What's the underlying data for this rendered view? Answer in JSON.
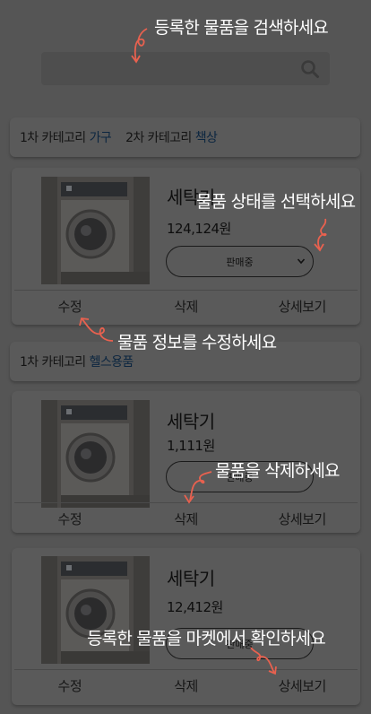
{
  "search": {
    "placeholder": ""
  },
  "categories": [
    {
      "first_label": "1차 카테고리",
      "first_value": "가구",
      "second_label": "2차 카테고리",
      "second_value": "책상"
    },
    {
      "first_label": "1차 카테고리",
      "first_value": "헬스용품"
    }
  ],
  "products": [
    {
      "title": "세탁기",
      "price": "124,124원",
      "status": "판매중",
      "edit": "수정",
      "delete": "삭제",
      "detail": "상세보기"
    },
    {
      "title": "세탁기",
      "price": "1,111원",
      "status": "판매중",
      "edit": "수정",
      "delete": "삭제",
      "detail": "상세보기"
    },
    {
      "title": "세탁기",
      "price": "12,412원",
      "status": "판매중",
      "edit": "수정",
      "delete": "삭제",
      "detail": "상세보기"
    }
  ],
  "tips": {
    "search": "등록한 물품을 검색하세요",
    "status": "물품 상태를 선택하세요",
    "edit": "물품 정보를 수정하세요",
    "delete": "물품을 삭제하세요",
    "market": "등록한 물품을 마켓에서 확인하세요"
  },
  "colors": {
    "overlay": "#555555",
    "tip_text": "#ffffff",
    "arrow": "#e8614f",
    "category_value": "#0c2640"
  },
  "icons": {
    "search": "search-icon",
    "status_dropdown": "chevron-down-icon",
    "thumbnail": "washing-machine-photo"
  }
}
